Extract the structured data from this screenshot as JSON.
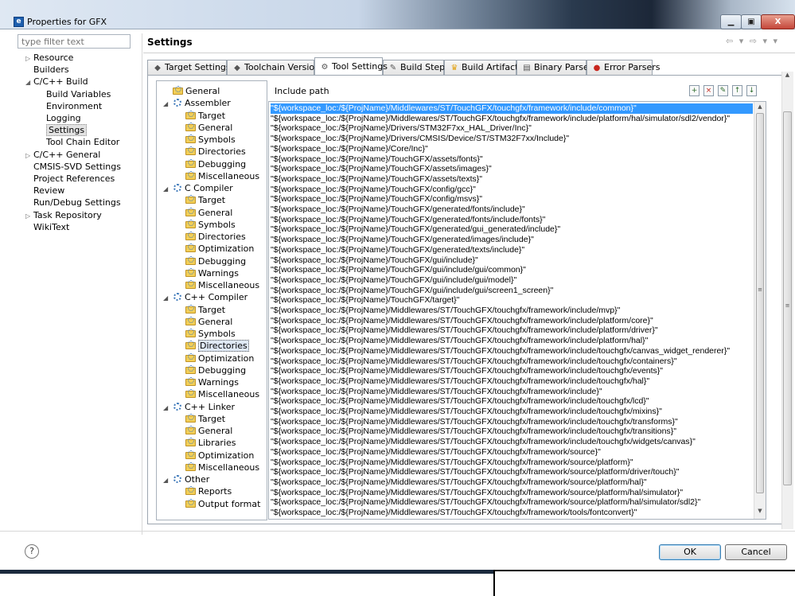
{
  "window": {
    "icon_label": "e",
    "title": "Properties for GFX"
  },
  "filter": {
    "placeholder": "type filter text"
  },
  "left_tree": {
    "items": [
      {
        "label": "Resource",
        "expander": "▷",
        "depth": 0
      },
      {
        "label": "Builders",
        "expander": "",
        "depth": 0
      },
      {
        "label": "C/C++ Build",
        "expander": "◢",
        "depth": 0
      },
      {
        "label": "Build Variables",
        "expander": "",
        "depth": 1
      },
      {
        "label": "Environment",
        "expander": "",
        "depth": 1
      },
      {
        "label": "Logging",
        "expander": "",
        "depth": 1
      },
      {
        "label": "Settings",
        "expander": "",
        "depth": 1,
        "selected": true
      },
      {
        "label": "Tool Chain Editor",
        "expander": "",
        "depth": 1
      },
      {
        "label": "C/C++ General",
        "expander": "▷",
        "depth": 0
      },
      {
        "label": "CMSIS-SVD Settings",
        "expander": "",
        "depth": 0
      },
      {
        "label": "Project References",
        "expander": "",
        "depth": 0
      },
      {
        "label": "Review",
        "expander": "",
        "depth": 0
      },
      {
        "label": "Run/Debug Settings",
        "expander": "",
        "depth": 0
      },
      {
        "label": "Task Repository",
        "expander": "▷",
        "depth": 0
      },
      {
        "label": "WikiText",
        "expander": "",
        "depth": 0
      }
    ]
  },
  "header": {
    "title": "Settings",
    "nav": "⇦ ▾ ⇨ ▾ ▾"
  },
  "tabs": [
    {
      "label": "Target Settings",
      "icon": "◆"
    },
    {
      "label": "Toolchain Version",
      "icon": "◆"
    },
    {
      "label": "Tool Settings",
      "icon": "⚙",
      "active": true
    },
    {
      "label": "Build Steps",
      "icon": "✎"
    },
    {
      "label": "Build Artifact",
      "icon": "♛"
    },
    {
      "label": "Binary Parsers",
      "icon": "▤"
    },
    {
      "label": "Error Parsers",
      "icon": "●"
    }
  ],
  "tool_tree": {
    "items": [
      {
        "label": "General",
        "depth": 0,
        "type": "leaf"
      },
      {
        "label": "Assembler",
        "depth": 0,
        "type": "group"
      },
      {
        "label": "Target",
        "depth": 1,
        "type": "leaf"
      },
      {
        "label": "General",
        "depth": 1,
        "type": "leaf"
      },
      {
        "label": "Symbols",
        "depth": 1,
        "type": "leaf"
      },
      {
        "label": "Directories",
        "depth": 1,
        "type": "leaf"
      },
      {
        "label": "Debugging",
        "depth": 1,
        "type": "leaf"
      },
      {
        "label": "Miscellaneous",
        "depth": 1,
        "type": "leaf"
      },
      {
        "label": "C Compiler",
        "depth": 0,
        "type": "group"
      },
      {
        "label": "Target",
        "depth": 1,
        "type": "leaf"
      },
      {
        "label": "General",
        "depth": 1,
        "type": "leaf"
      },
      {
        "label": "Symbols",
        "depth": 1,
        "type": "leaf"
      },
      {
        "label": "Directories",
        "depth": 1,
        "type": "leaf"
      },
      {
        "label": "Optimization",
        "depth": 1,
        "type": "leaf"
      },
      {
        "label": "Debugging",
        "depth": 1,
        "type": "leaf"
      },
      {
        "label": "Warnings",
        "depth": 1,
        "type": "leaf"
      },
      {
        "label": "Miscellaneous",
        "depth": 1,
        "type": "leaf"
      },
      {
        "label": "C++ Compiler",
        "depth": 0,
        "type": "group"
      },
      {
        "label": "Target",
        "depth": 1,
        "type": "leaf"
      },
      {
        "label": "General",
        "depth": 1,
        "type": "leaf"
      },
      {
        "label": "Symbols",
        "depth": 1,
        "type": "leaf"
      },
      {
        "label": "Directories",
        "depth": 1,
        "type": "leaf",
        "selected": true
      },
      {
        "label": "Optimization",
        "depth": 1,
        "type": "leaf"
      },
      {
        "label": "Debugging",
        "depth": 1,
        "type": "leaf"
      },
      {
        "label": "Warnings",
        "depth": 1,
        "type": "leaf"
      },
      {
        "label": "Miscellaneous",
        "depth": 1,
        "type": "leaf"
      },
      {
        "label": "C++ Linker",
        "depth": 0,
        "type": "group"
      },
      {
        "label": "Target",
        "depth": 1,
        "type": "leaf"
      },
      {
        "label": "General",
        "depth": 1,
        "type": "leaf"
      },
      {
        "label": "Libraries",
        "depth": 1,
        "type": "leaf"
      },
      {
        "label": "Optimization",
        "depth": 1,
        "type": "leaf"
      },
      {
        "label": "Miscellaneous",
        "depth": 1,
        "type": "leaf"
      },
      {
        "label": "Other",
        "depth": 0,
        "type": "group"
      },
      {
        "label": "Reports",
        "depth": 1,
        "type": "leaf"
      },
      {
        "label": "Output format",
        "depth": 1,
        "type": "leaf"
      }
    ]
  },
  "include_panel": {
    "title": "Include path",
    "toolbar": [
      "add-icon",
      "delete-icon",
      "edit-icon",
      "move-up-icon",
      "move-down-icon"
    ],
    "paths": [
      "\"${workspace_loc:/${ProjName}/Middlewares/ST/TouchGFX/touchgfx/framework/include/common}\"",
      "\"${workspace_loc:/${ProjName}/Middlewares/ST/TouchGFX/touchgfx/framework/include/platform/hal/simulator/sdl2/vendor}\"",
      "\"${workspace_loc:/${ProjName}/Drivers/STM32F7xx_HAL_Driver/Inc}\"",
      "\"${workspace_loc:/${ProjName}/Drivers/CMSIS/Device/ST/STM32F7xx/Include}\"",
      "\"${workspace_loc:/${ProjName}/Core/Inc}\"",
      "\"${workspace_loc:/${ProjName}/TouchGFX/assets/fonts}\"",
      "\"${workspace_loc:/${ProjName}/TouchGFX/assets/images}\"",
      "\"${workspace_loc:/${ProjName}/TouchGFX/assets/texts}\"",
      "\"${workspace_loc:/${ProjName}/TouchGFX/config/gcc}\"",
      "\"${workspace_loc:/${ProjName}/TouchGFX/config/msvs}\"",
      "\"${workspace_loc:/${ProjName}/TouchGFX/generated/fonts/include}\"",
      "\"${workspace_loc:/${ProjName}/TouchGFX/generated/fonts/include/fonts}\"",
      "\"${workspace_loc:/${ProjName}/TouchGFX/generated/gui_generated/include}\"",
      "\"${workspace_loc:/${ProjName}/TouchGFX/generated/images/include}\"",
      "\"${workspace_loc:/${ProjName}/TouchGFX/generated/texts/include}\"",
      "\"${workspace_loc:/${ProjName}/TouchGFX/gui/include}\"",
      "\"${workspace_loc:/${ProjName}/TouchGFX/gui/include/gui/common}\"",
      "\"${workspace_loc:/${ProjName}/TouchGFX/gui/include/gui/model}\"",
      "\"${workspace_loc:/${ProjName}/TouchGFX/gui/include/gui/screen1_screen}\"",
      "\"${workspace_loc:/${ProjName}/TouchGFX/target}\"",
      "\"${workspace_loc:/${ProjName}/Middlewares/ST/TouchGFX/touchgfx/framework/include/mvp}\"",
      "\"${workspace_loc:/${ProjName}/Middlewares/ST/TouchGFX/touchgfx/framework/include/platform/core}\"",
      "\"${workspace_loc:/${ProjName}/Middlewares/ST/TouchGFX/touchgfx/framework/include/platform/driver}\"",
      "\"${workspace_loc:/${ProjName}/Middlewares/ST/TouchGFX/touchgfx/framework/include/platform/hal}\"",
      "\"${workspace_loc:/${ProjName}/Middlewares/ST/TouchGFX/touchgfx/framework/include/touchgfx/canvas_widget_renderer}\"",
      "\"${workspace_loc:/${ProjName}/Middlewares/ST/TouchGFX/touchgfx/framework/include/touchgfx/containers}\"",
      "\"${workspace_loc:/${ProjName}/Middlewares/ST/TouchGFX/touchgfx/framework/include/touchgfx/events}\"",
      "\"${workspace_loc:/${ProjName}/Middlewares/ST/TouchGFX/touchgfx/framework/include/touchgfx/hal}\"",
      "\"${workspace_loc:/${ProjName}/Middlewares/ST/TouchGFX/touchgfx/framework/include}\"",
      "\"${workspace_loc:/${ProjName}/Middlewares/ST/TouchGFX/touchgfx/framework/include/touchgfx/lcd}\"",
      "\"${workspace_loc:/${ProjName}/Middlewares/ST/TouchGFX/touchgfx/framework/include/touchgfx/mixins}\"",
      "\"${workspace_loc:/${ProjName}/Middlewares/ST/TouchGFX/touchgfx/framework/include/touchgfx/transforms}\"",
      "\"${workspace_loc:/${ProjName}/Middlewares/ST/TouchGFX/touchgfx/framework/include/touchgfx/transitions}\"",
      "\"${workspace_loc:/${ProjName}/Middlewares/ST/TouchGFX/touchgfx/framework/include/touchgfx/widgets/canvas}\"",
      "\"${workspace_loc:/${ProjName}/Middlewares/ST/TouchGFX/touchgfx/framework/source}\"",
      "\"${workspace_loc:/${ProjName}/Middlewares/ST/TouchGFX/touchgfx/framework/source/platform}\"",
      "\"${workspace_loc:/${ProjName}/Middlewares/ST/TouchGFX/touchgfx/framework/source/platform/driver/touch}\"",
      "\"${workspace_loc:/${ProjName}/Middlewares/ST/TouchGFX/touchgfx/framework/source/platform/hal}\"",
      "\"${workspace_loc:/${ProjName}/Middlewares/ST/TouchGFX/touchgfx/framework/source/platform/hal/simulator}\"",
      "\"${workspace_loc:/${ProjName}/Middlewares/ST/TouchGFX/touchgfx/framework/source/platform/hal/simulator/sdl2}\"",
      "\"${workspace_loc:/${ProjName}/Middlewares/ST/TouchGFX/touchgfx/framework/tools/fontconvert}\""
    ]
  },
  "buttons": {
    "help": "?",
    "ok": "OK",
    "cancel": "Cancel"
  },
  "caption_buttons": {
    "minimize": "▁",
    "maximize": "▣",
    "close": "X"
  },
  "colors": {
    "selection": "#3399ff",
    "accent": "#1e5fae"
  }
}
